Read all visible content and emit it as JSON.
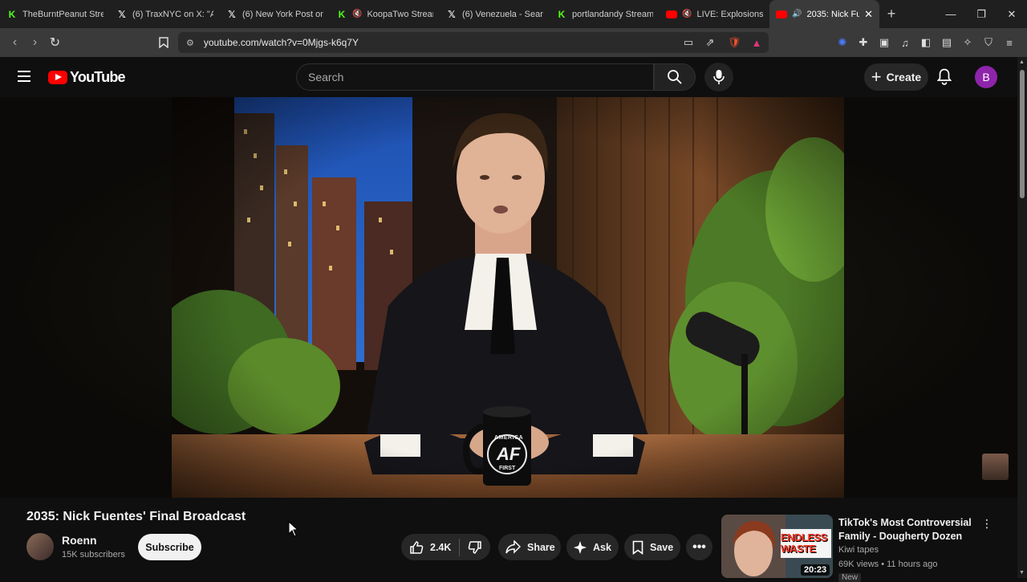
{
  "browser": {
    "tabs": [
      {
        "title": "TheBurntPeanut Strea",
        "favicon": "kick-icon"
      },
      {
        "title": "(6) TraxNYC on X: \"An",
        "favicon": "x-icon"
      },
      {
        "title": "(6) New York Post on",
        "favicon": "x-icon"
      },
      {
        "title": "KoopaTwo Stream",
        "favicon": "kick-icon"
      },
      {
        "title": "(6) Venezuela - Searcl",
        "favicon": "x-icon"
      },
      {
        "title": "portlandandy Stream",
        "favicon": "kick-icon"
      },
      {
        "title": "LIVE: Explosions h",
        "favicon": "youtube-icon"
      },
      {
        "title": "2035: Nick Fu",
        "favicon": "youtube-icon"
      }
    ],
    "new_tab": "+",
    "url": "youtube.com/watch?v=0Mjgs-k6q7Y"
  },
  "youtube": {
    "logo_text": "YouTube",
    "search_placeholder": "Search",
    "create_label": "Create",
    "avatar_letter": "B"
  },
  "video": {
    "title": "2035: Nick Fuentes' Final Broadcast",
    "channel_name": "Roenn",
    "subscribers": "15K subscribers",
    "subscribe_label": "Subscribe",
    "likes": "2.4K",
    "share_label": "Share",
    "ask_label": "Ask",
    "save_label": "Save",
    "mug_top": "AMERICA",
    "mug_logo": "AF",
    "mug_bottom": "FIRST"
  },
  "recommendation": {
    "title": "TikTok's Most Controversial Family - Dougherty Dozen",
    "channel": "Kiwi tapes",
    "meta": "69K views • 11 hours ago",
    "badge": "New",
    "duration": "20:23",
    "thumb_text_1": "ENDLESS",
    "thumb_text_2": "WASTE"
  },
  "colors": {
    "youtube_red": "#ff0000",
    "kick_green": "#53fc18",
    "avatar_purple": "#8e24aa"
  }
}
